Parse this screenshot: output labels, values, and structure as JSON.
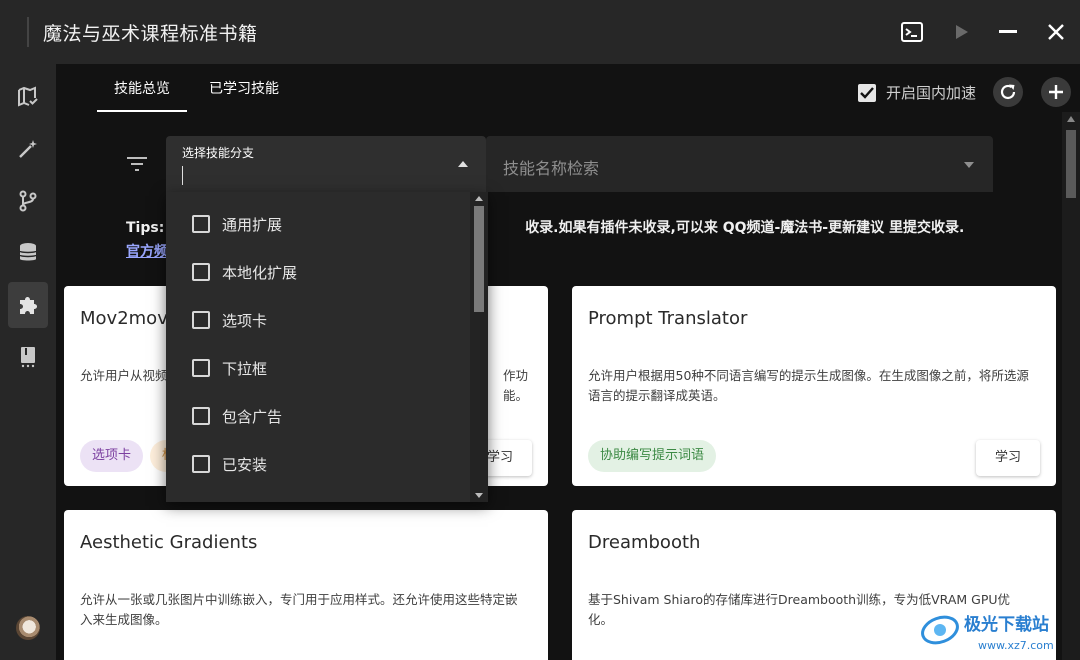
{
  "window": {
    "title": "魔法与巫术课程标准书籍"
  },
  "tabs": [
    {
      "label": "技能总览",
      "active": true
    },
    {
      "label": "已学习技能",
      "active": false
    }
  ],
  "toolbar": {
    "accel_label": "开启国内加速",
    "accel_checked": true
  },
  "filter": {
    "select_label": "选择技能分支",
    "search_placeholder": "技能名称检索"
  },
  "tips": {
    "prefix": "Tips: ",
    "text_suffix": "收录.如果有插件未收录,可以来 QQ频道-魔法书-更新建议 里提交收录.",
    "link_partial": "官方频"
  },
  "dropdown_options": [
    {
      "label": "通用扩展",
      "checked": false
    },
    {
      "label": "本地化扩展",
      "checked": false
    },
    {
      "label": "选项卡",
      "checked": false
    },
    {
      "label": "下拉框",
      "checked": false
    },
    {
      "label": "包含广告",
      "checked": false
    },
    {
      "label": "已安装",
      "checked": false
    }
  ],
  "cards": [
    {
      "title": "Mov2mov",
      "desc": "允许用户从视频中",
      "desc_tail": "作功\n能。",
      "tags": [
        "选项卡",
        "标"
      ],
      "action": "学习"
    },
    {
      "title": "Prompt Translator",
      "desc": "允许用户根据用50种不同语言编写的提示生成图像。在生成图像之前，将所选源语言的提示翻译成英语。",
      "tags": [
        "协助编写提示词语"
      ],
      "action": "学习"
    },
    {
      "title": "Aesthetic Gradients",
      "desc": "允许从一张或几张图片中训练嵌入，专门用于应用样式。还允许使用这些特定嵌入来生成图像。",
      "tags": [],
      "action": ""
    },
    {
      "title": "Dreambooth",
      "desc": "基于Shivam Shiaro的存储库进行Dreambooth训练，专为低VRAM GPU优化。",
      "tags": [],
      "action": ""
    }
  ],
  "watermark": {
    "text": "极光下载站",
    "url": "www.xz7.com"
  },
  "colors": {
    "titlebar_bg": "#272727",
    "main_bg": "#121212",
    "tag_purple_bg": "#ece2f5",
    "tag_purple_fg": "#7b3fa0",
    "tag_green_bg": "#e3f1e4",
    "tag_green_fg": "#3d8a45",
    "tag_orange_bg": "#fdeedb"
  }
}
